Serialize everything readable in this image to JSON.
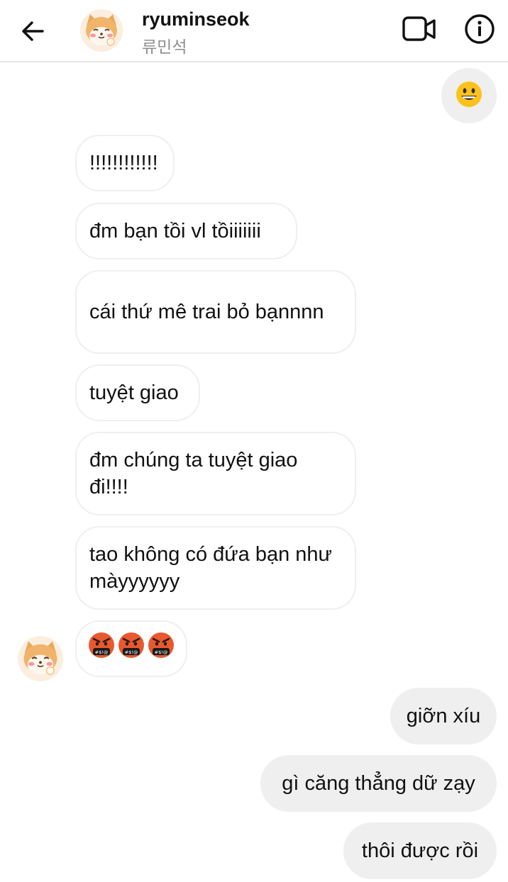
{
  "header": {
    "username": "ryuminseok",
    "subname": "류민석"
  },
  "sent_top": {
    "emoji": "grinning-face-emoji"
  },
  "received": [
    {
      "text": "!!!!!!!!!!!!"
    },
    {
      "text": "đm bạn tồi vl tồiiiiiii"
    },
    {
      "text": "cái thứ mê trai bỏ bạnnnn"
    },
    {
      "text": "tuyệt giao"
    },
    {
      "text": "đm chúng ta tuyệt giao đi!!!!"
    },
    {
      "text": "tao không có đứa bạn như màyyyyyy"
    }
  ],
  "received_emoji": {
    "emojis": [
      "cursing-face-emoji",
      "cursing-face-emoji",
      "cursing-face-emoji"
    ]
  },
  "sent": [
    {
      "text": "giỡn xíu"
    },
    {
      "text": "gì căng thẳng dữ zạy"
    },
    {
      "text": "thôi được rồi"
    }
  ],
  "colors": {
    "sent_bubble": "#efefef",
    "received_border": "#efefef",
    "subtext": "#8e8e8e"
  }
}
